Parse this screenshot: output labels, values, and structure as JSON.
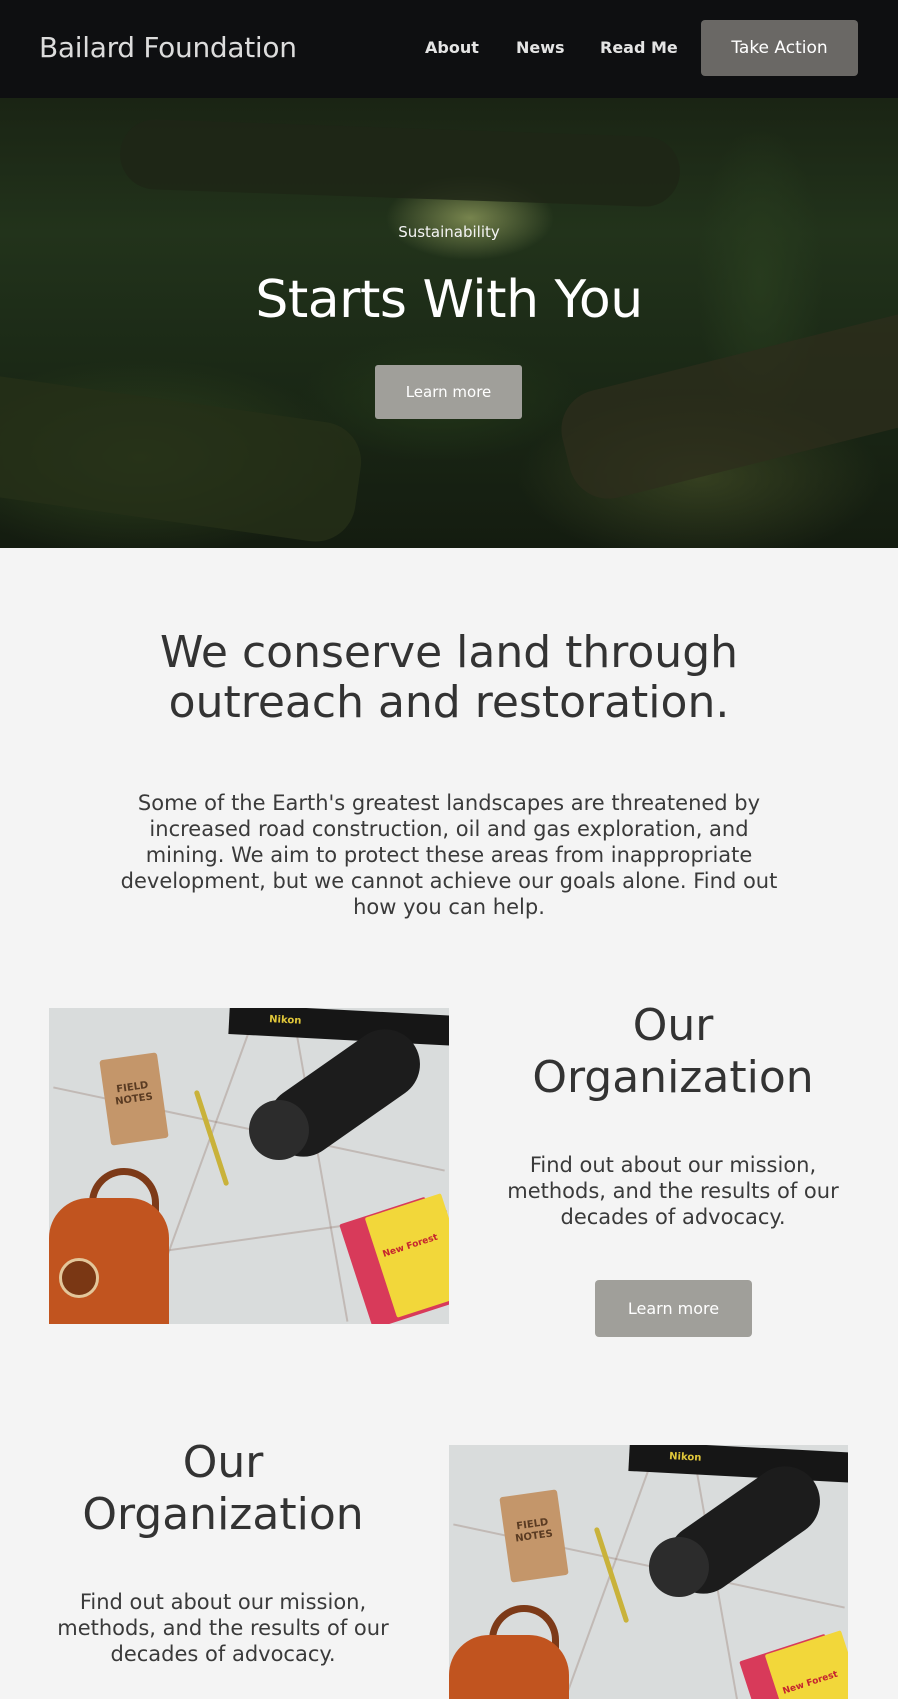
{
  "header": {
    "brand": "Bailard Foundation",
    "nav": [
      "About",
      "News",
      "Read Me"
    ],
    "cta": "Take Action"
  },
  "hero": {
    "subtitle": "Sustainability",
    "title": "Starts With You",
    "button": "Learn more"
  },
  "intro": {
    "title": "We conserve land through outreach and restoration.",
    "body": "Some of the Earth's greatest landscapes are threatened by increased road construction, oil and gas exploration, and mining. We aim to protect these areas from inappropriate development, but we cannot achieve our goals alone. Find out how you can help."
  },
  "sections": [
    {
      "title": "Our Organization",
      "body": "Find out about our mission, methods, and the results of our decades of advocacy.",
      "button": "Learn more"
    },
    {
      "title": "Our Organization",
      "body": "Find out about our mission, methods, and the results of our decades of advocacy."
    }
  ],
  "photo": {
    "notebook_text": "FIELD NOTES",
    "strap_text": "Nikon",
    "book_text": "New Forest"
  },
  "colors": {
    "header_bg": "#0e0f11",
    "cta_bg": "#6a6865",
    "button_bg": "#a09f9a",
    "page_bg": "#f4f4f4",
    "text": "#333333"
  }
}
